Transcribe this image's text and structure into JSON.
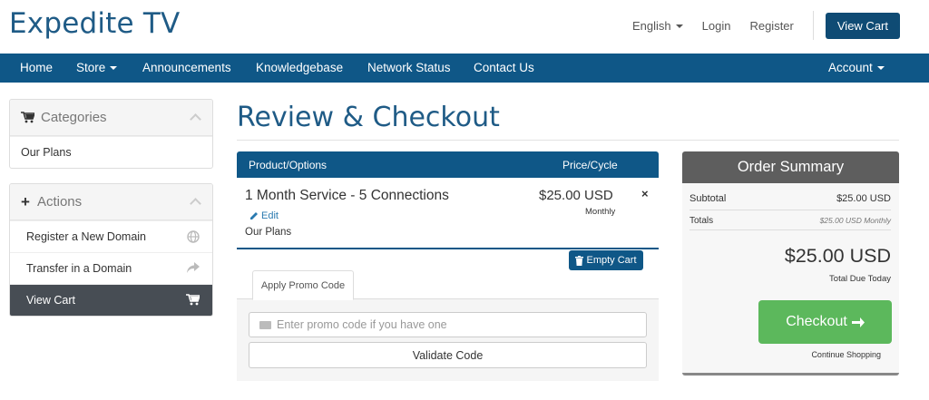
{
  "brand": {
    "name": "Expedite TV"
  },
  "topbar": {
    "language": "English",
    "login": "Login",
    "register": "Register",
    "view_cart": "View Cart"
  },
  "nav": {
    "items": [
      "Home",
      "Store",
      "Announcements",
      "Knowledgebase",
      "Network Status",
      "Contact Us"
    ],
    "account": "Account"
  },
  "sidebar": {
    "categories": {
      "title": "Categories",
      "items": [
        "Our Plans"
      ]
    },
    "actions": {
      "title": "Actions",
      "items": [
        "Register a New Domain",
        "Transfer in a Domain",
        "View Cart"
      ]
    }
  },
  "main": {
    "title": "Review & Checkout",
    "cart": {
      "col_product": "Product/Options",
      "col_price": "Price/Cycle",
      "item": {
        "name": "1 Month Service - 5 Connections",
        "edit": "Edit",
        "group": "Our Plans",
        "price": "$25.00 USD",
        "cycle": "Monthly",
        "remove": "×"
      },
      "empty_cart": "Empty Cart"
    },
    "promo": {
      "tab": "Apply Promo Code",
      "placeholder": "Enter promo code if you have one",
      "validate": "Validate Code"
    }
  },
  "summary": {
    "title": "Order Summary",
    "subtotal_label": "Subtotal",
    "subtotal_value": "$25.00 USD",
    "totals_label": "Totals",
    "totals_value": "$25.00 USD Monthly",
    "total_due": "$25.00 USD",
    "total_due_label": "Total Due Today",
    "checkout": "Checkout",
    "continue": "Continue Shopping"
  },
  "colors": {
    "brand": "#1f5b86",
    "navbar": "#0f5787",
    "checkout": "#5cb85c",
    "summary_head": "#5e5e5e",
    "active_row": "#474d54"
  }
}
